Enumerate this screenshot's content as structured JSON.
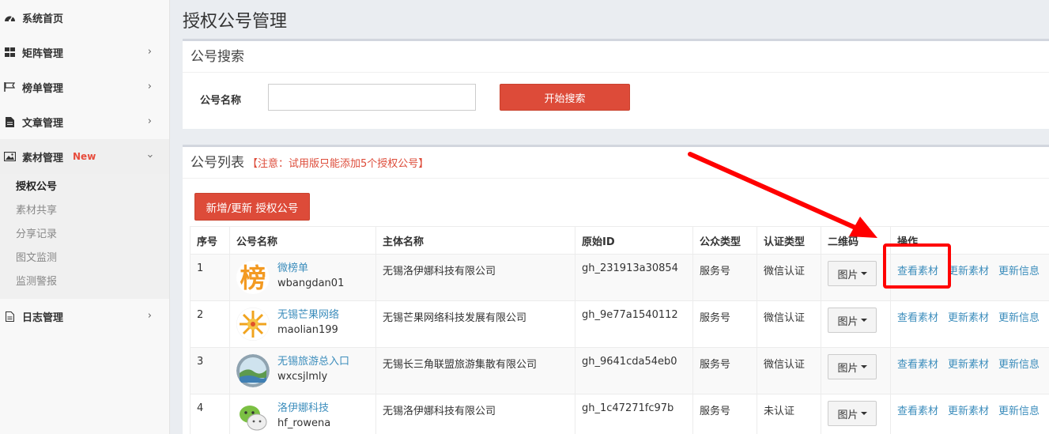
{
  "sidebar": {
    "items": [
      {
        "label": "系统首页",
        "icon": "dashboard-icon"
      },
      {
        "label": "矩阵管理",
        "icon": "grid-icon"
      },
      {
        "label": "榜单管理",
        "icon": "flag-icon"
      },
      {
        "label": "文章管理",
        "icon": "document-icon"
      },
      {
        "label": "素材管理",
        "icon": "image-icon",
        "badge": "New"
      },
      {
        "label": "日志管理",
        "icon": "file-icon"
      }
    ],
    "submenu": [
      "授权公号",
      "素材共享",
      "分享记录",
      "图文监测",
      "监测警报"
    ]
  },
  "page_title": "授权公号管理",
  "search": {
    "title": "公号搜索",
    "label": "公号名称",
    "value": "",
    "button": "开始搜索"
  },
  "list": {
    "title": "公号列表",
    "note": "【注意：试用版只能添加5个授权公号】",
    "add_button": "新增/更新 授权公号",
    "columns": [
      "序号",
      "公号名称",
      "主体名称",
      "原始ID",
      "公众类型",
      "认证类型",
      "二维码",
      "操作"
    ],
    "rows": [
      {
        "no": "1",
        "name": "微榜单",
        "wxid": "wbangdan01",
        "entity": "无锡洛伊娜科技有限公司",
        "orig_id": "gh_231913a30854",
        "type": "服务号",
        "verify": "微信认证",
        "avatar": "bang-logo"
      },
      {
        "no": "2",
        "name": "无锡芒果网络",
        "wxid": "maolian199",
        "entity": "无锡芒果网络科技发展有限公司",
        "orig_id": "gh_9e77a1540112",
        "type": "服务号",
        "verify": "微信认证",
        "avatar": "sun-logo"
      },
      {
        "no": "3",
        "name": "无锡旅游总入口",
        "wxid": "wxcsjlmly",
        "entity": "无锡长三角联盟旅游集散有限公司",
        "orig_id": "gh_9641cda54eb0",
        "type": "服务号",
        "verify": "微信认证",
        "avatar": "landscape-logo"
      },
      {
        "no": "4",
        "name": "洛伊娜科技",
        "wxid": "hf_rowena",
        "entity": "无锡洛伊娜科技有限公司",
        "orig_id": "gh_1c47271fc97b",
        "type": "服务号",
        "verify": "未认证",
        "avatar": "wechat-logo"
      }
    ],
    "qr_button": "图片",
    "ops": [
      "查看素材",
      "更新素材",
      "更新信息"
    ]
  },
  "colors": {
    "accent_red": "#dd4b39",
    "link_blue": "#3c8dbc",
    "highlight": "#ff0000"
  }
}
